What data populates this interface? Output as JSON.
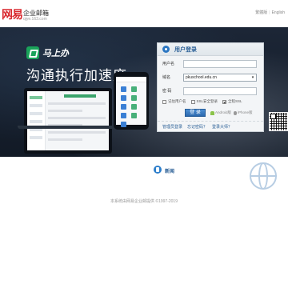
{
  "header": {
    "logo_mark": "网易",
    "title": "企业邮箱",
    "domain": "qiye.163.com",
    "links": [
      "繁體版",
      "English"
    ]
  },
  "banner": {
    "brand": "马上办",
    "slogan": "沟通执行加速度"
  },
  "login": {
    "title": "用户登录",
    "username_label": "用户名",
    "username_value": "",
    "domain_label": "域名",
    "domain_value": "pkuschool.edu.cn",
    "password_label": "密 码",
    "password_value": "",
    "remember_label": "记住用户名",
    "ssl_label": "SSL安全登录",
    "full_ssl_label": "全程SSL",
    "login_button": "登 录",
    "android_label": "Android版",
    "iphone_label": "iPhone版",
    "admin_link": "管理员登录",
    "forgot_link": "忘记密码？",
    "help_link": "登录大师？",
    "remember_checked": false,
    "ssl_checked": false,
    "full_ssl_checked": true
  },
  "news": {
    "label": "新闻"
  },
  "footer": {
    "copyright": "本系统由网易企业邮提供 ©1997-2019"
  },
  "colors": {
    "brand_red": "#d8262c",
    "link_blue": "#2a5f96",
    "button_blue": "#2b69ae",
    "banner_bg": "#152032"
  }
}
